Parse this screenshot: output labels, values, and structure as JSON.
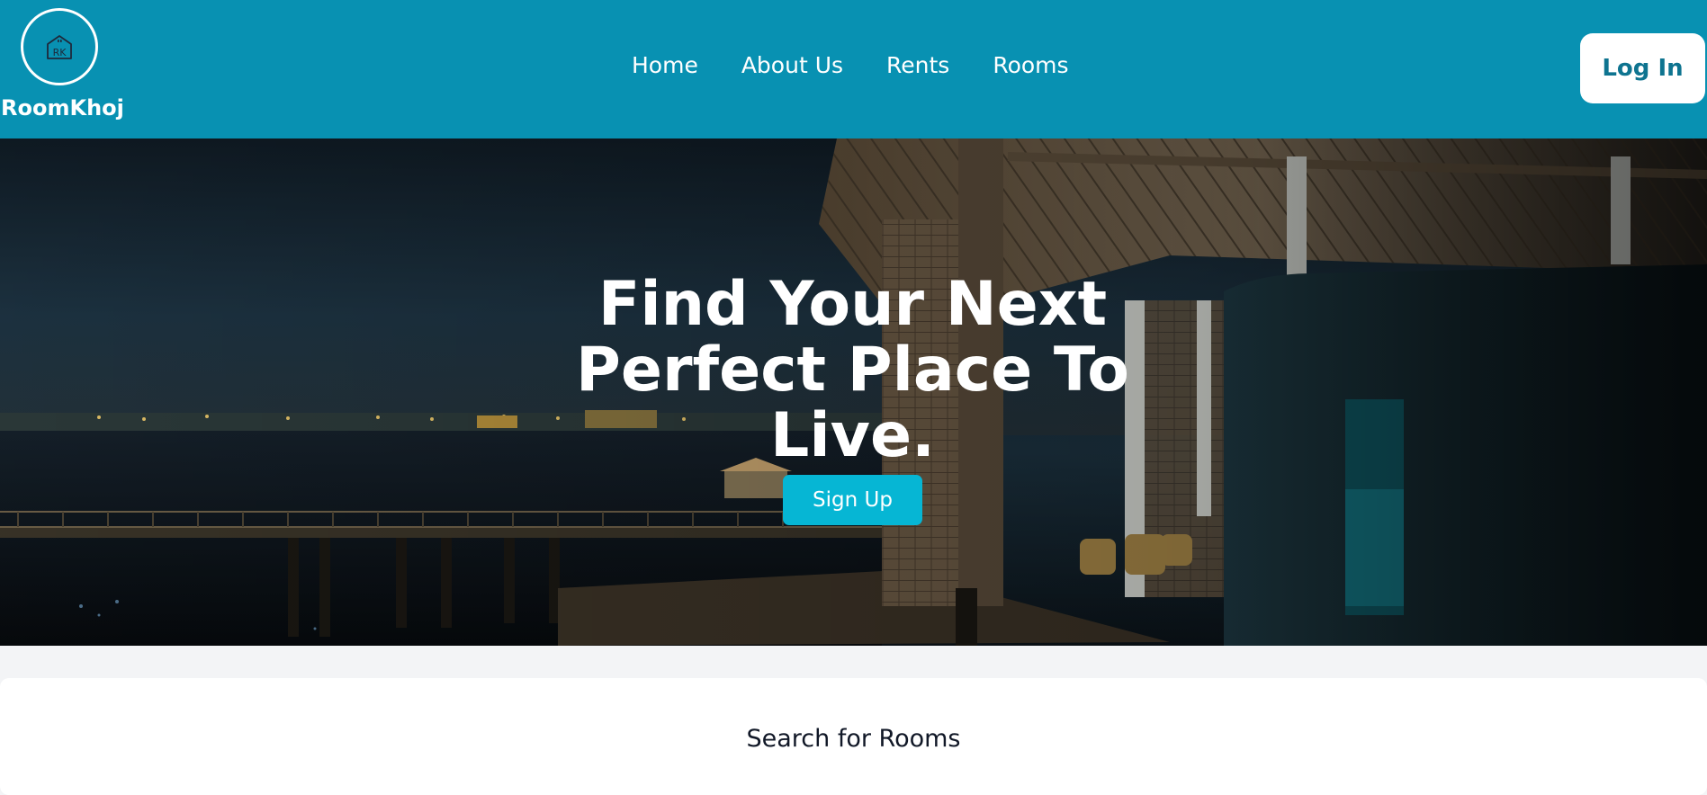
{
  "brand": {
    "name": "RoomKhoj",
    "logo_text": "RK",
    "logo_icon": "house-icon"
  },
  "nav": {
    "items": [
      {
        "label": "Home"
      },
      {
        "label": "About Us"
      },
      {
        "label": "Rents"
      },
      {
        "label": "Rooms"
      }
    ],
    "login_label": "Log In"
  },
  "hero": {
    "title": "Find Your Next Perfect Place To Live.",
    "signup_label": "Sign Up",
    "background": "night-resort-photo"
  },
  "search": {
    "title": "Search for Rooms"
  },
  "colors": {
    "primary": "#0891b2",
    "accent": "#06b6d4",
    "login_text": "#0e7490",
    "page_bg": "#f3f4f6"
  }
}
